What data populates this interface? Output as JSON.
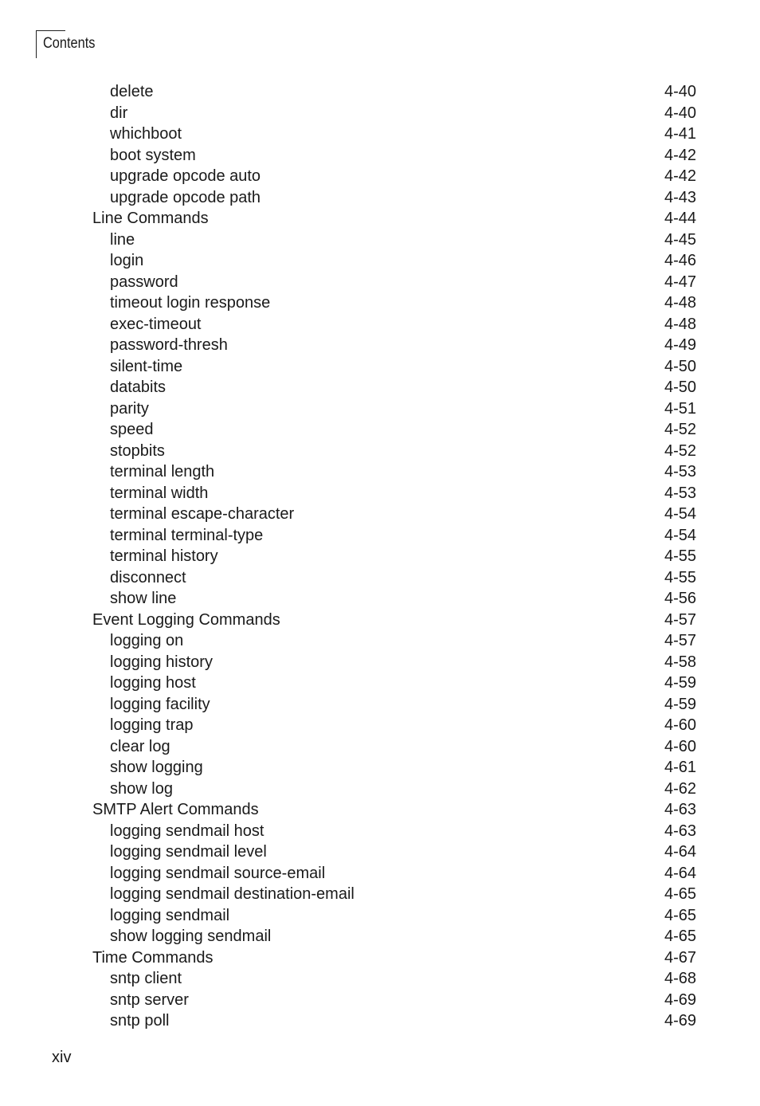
{
  "header": {
    "title": "Contents"
  },
  "toc": [
    {
      "label": "delete",
      "page": "4-40",
      "level": 2
    },
    {
      "label": "dir",
      "page": "4-40",
      "level": 2
    },
    {
      "label": "whichboot",
      "page": "4-41",
      "level": 2
    },
    {
      "label": "boot system",
      "page": "4-42",
      "level": 2
    },
    {
      "label": "upgrade opcode auto",
      "page": "4-42",
      "level": 2
    },
    {
      "label": "upgrade opcode path",
      "page": "4-43",
      "level": 2
    },
    {
      "label": "Line Commands",
      "page": "4-44",
      "level": 1
    },
    {
      "label": "line",
      "page": "4-45",
      "level": 2
    },
    {
      "label": "login",
      "page": "4-46",
      "level": 2
    },
    {
      "label": "password",
      "page": "4-47",
      "level": 2
    },
    {
      "label": "timeout login response",
      "page": "4-48",
      "level": 2
    },
    {
      "label": "exec-timeout",
      "page": "4-48",
      "level": 2
    },
    {
      "label": "password-thresh",
      "page": "4-49",
      "level": 2
    },
    {
      "label": "silent-time",
      "page": "4-50",
      "level": 2
    },
    {
      "label": "databits",
      "page": "4-50",
      "level": 2
    },
    {
      "label": "parity",
      "page": "4-51",
      "level": 2
    },
    {
      "label": "speed",
      "page": "4-52",
      "level": 2
    },
    {
      "label": "stopbits",
      "page": "4-52",
      "level": 2
    },
    {
      "label": "terminal length",
      "page": "4-53",
      "level": 2
    },
    {
      "label": "terminal width",
      "page": "4-53",
      "level": 2
    },
    {
      "label": "terminal escape-character",
      "page": "4-54",
      "level": 2
    },
    {
      "label": "terminal terminal-type",
      "page": "4-54",
      "level": 2
    },
    {
      "label": "terminal history",
      "page": "4-55",
      "level": 2
    },
    {
      "label": "disconnect",
      "page": "4-55",
      "level": 2
    },
    {
      "label": "show line",
      "page": "4-56",
      "level": 2
    },
    {
      "label": "Event Logging Commands",
      "page": "4-57",
      "level": 1
    },
    {
      "label": "logging on",
      "page": "4-57",
      "level": 2
    },
    {
      "label": "logging history",
      "page": "4-58",
      "level": 2
    },
    {
      "label": "logging host",
      "page": "4-59",
      "level": 2
    },
    {
      "label": "logging facility",
      "page": "4-59",
      "level": 2
    },
    {
      "label": "logging trap",
      "page": "4-60",
      "level": 2
    },
    {
      "label": "clear log",
      "page": "4-60",
      "level": 2
    },
    {
      "label": "show logging",
      "page": "4-61",
      "level": 2
    },
    {
      "label": "show log",
      "page": "4-62",
      "level": 2
    },
    {
      "label": "SMTP Alert Commands",
      "page": "4-63",
      "level": 1
    },
    {
      "label": "logging sendmail host",
      "page": "4-63",
      "level": 2
    },
    {
      "label": "logging sendmail level",
      "page": "4-64",
      "level": 2
    },
    {
      "label": "logging sendmail source-email",
      "page": "4-64",
      "level": 2
    },
    {
      "label": "logging sendmail destination-email",
      "page": "4-65",
      "level": 2
    },
    {
      "label": "logging sendmail",
      "page": "4-65",
      "level": 2
    },
    {
      "label": "show logging sendmail",
      "page": "4-65",
      "level": 2
    },
    {
      "label": "Time Commands",
      "page": "4-67",
      "level": 1
    },
    {
      "label": "sntp client",
      "page": "4-68",
      "level": 2
    },
    {
      "label": "sntp server",
      "page": "4-69",
      "level": 2
    },
    {
      "label": "sntp poll",
      "page": "4-69",
      "level": 2
    }
  ],
  "footer": {
    "page_number": "xiv"
  }
}
